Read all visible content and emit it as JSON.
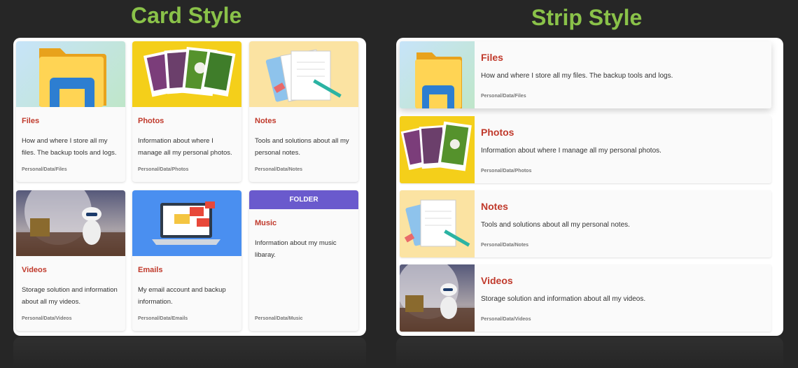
{
  "headings": {
    "card": "Card Style",
    "strip": "Strip Style"
  },
  "items": [
    {
      "title": "Files",
      "desc": "How and where I store all my files. The backup tools and logs.",
      "path": "Personal/Data/Files",
      "icon": "folder-icon"
    },
    {
      "title": "Photos",
      "desc": "Information about where I manage all my personal photos.",
      "path": "Personal/Data/Photos",
      "icon": "photos-icon"
    },
    {
      "title": "Notes",
      "desc": "Tools and solutions about all my personal notes.",
      "path": "Personal/Data/Notes",
      "icon": "notes-icon"
    },
    {
      "title": "Videos",
      "desc": "Storage solution and information about all my videos.",
      "path": "Personal/Data/Videos",
      "icon": "video-icon"
    },
    {
      "title": "Emails",
      "desc": "My email account and backup information.",
      "path": "Personal/Data/Emails",
      "icon": "email-icon"
    },
    {
      "title": "Music",
      "desc": "Information about my music libaray.",
      "path": "Personal/Data/Music",
      "banner": "FOLDER"
    }
  ],
  "colors": {
    "heading": "#8ac249",
    "title": "#c0392b",
    "banner": "#6a5acd"
  }
}
